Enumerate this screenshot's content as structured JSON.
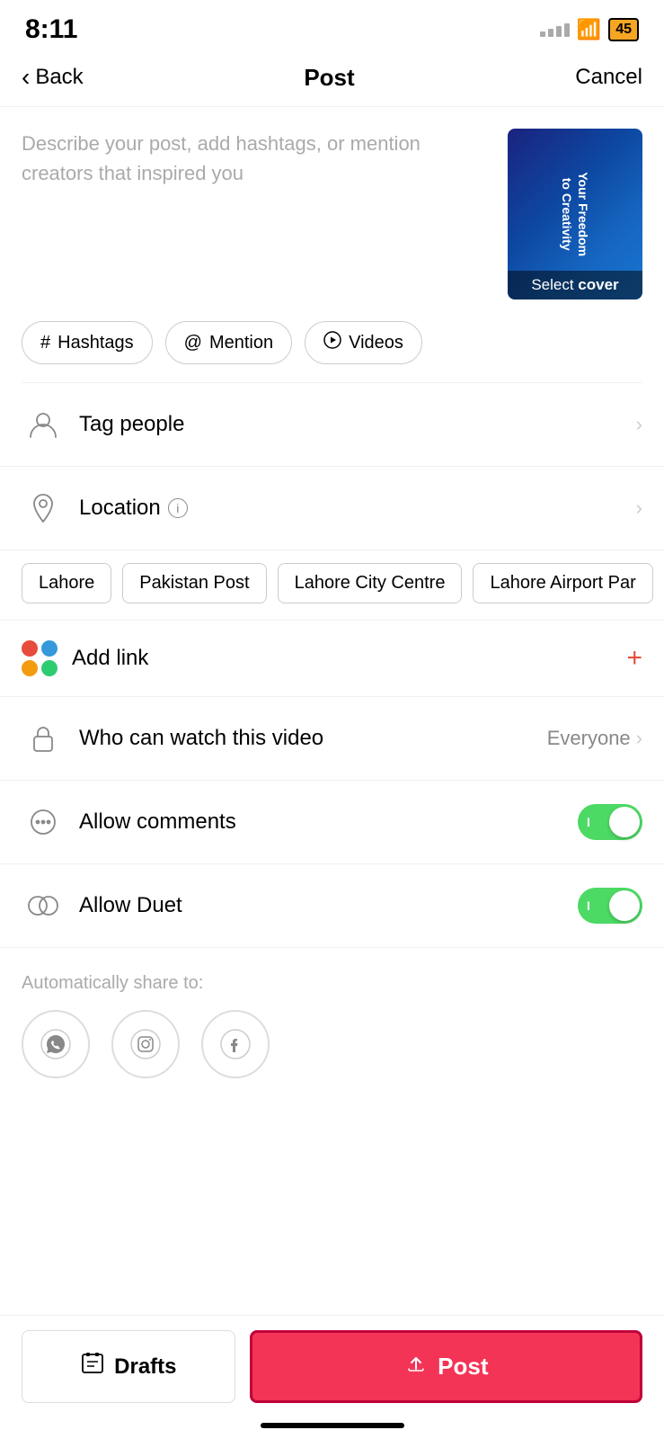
{
  "statusBar": {
    "time": "8:11",
    "batteryLevel": "45"
  },
  "header": {
    "backLabel": "Back",
    "title": "Post",
    "cancelLabel": "Cancel"
  },
  "description": {
    "placeholder": "Describe your post, add hashtags, or mention creators that inspired you",
    "coverLabel": "Select cover",
    "thumbnailAlt": "Your Freedom to Creativity"
  },
  "tagButtons": [
    {
      "icon": "#",
      "label": "Hashtags"
    },
    {
      "icon": "@",
      "label": "Mention"
    },
    {
      "icon": "▶",
      "label": "Videos"
    }
  ],
  "tagPeople": {
    "label": "Tag people"
  },
  "location": {
    "label": "Location",
    "chips": [
      "Lahore",
      "Pakistan Post",
      "Lahore City Centre",
      "Lahore Airport Par"
    ]
  },
  "addLink": {
    "label": "Add link"
  },
  "whoCanWatch": {
    "label": "Who can watch this video",
    "value": "Everyone"
  },
  "allowComments": {
    "label": "Allow comments",
    "toggleState": true,
    "toggleLabel": "I"
  },
  "allowDuet": {
    "label": "Allow Duet",
    "toggleState": true,
    "toggleLabel": "I"
  },
  "autoShare": {
    "sectionLabel": "Automatically share to:",
    "platforms": [
      "WhatsApp",
      "Instagram",
      "Facebook"
    ]
  },
  "bottomBar": {
    "draftsLabel": "Drafts",
    "postLabel": "Post"
  }
}
